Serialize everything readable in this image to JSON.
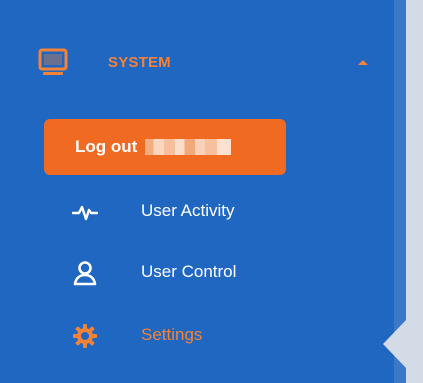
{
  "sidebar": {
    "section": {
      "title": "SYSTEM",
      "icon": "monitor-icon",
      "expanded": true
    },
    "logout": {
      "label": "Log out",
      "username_redacted": true
    },
    "items": [
      {
        "label": "User Activity",
        "icon": "activity-pulse-icon",
        "active": false
      },
      {
        "label": "User Control",
        "icon": "user-icon",
        "active": false
      },
      {
        "label": "Settings",
        "icon": "gear-icon",
        "active": true
      }
    ]
  },
  "colors": {
    "sidebar_bg": "#1f67c0",
    "accent": "#f58236",
    "logout_bg": "#f06a22",
    "text": "#ffffff"
  }
}
